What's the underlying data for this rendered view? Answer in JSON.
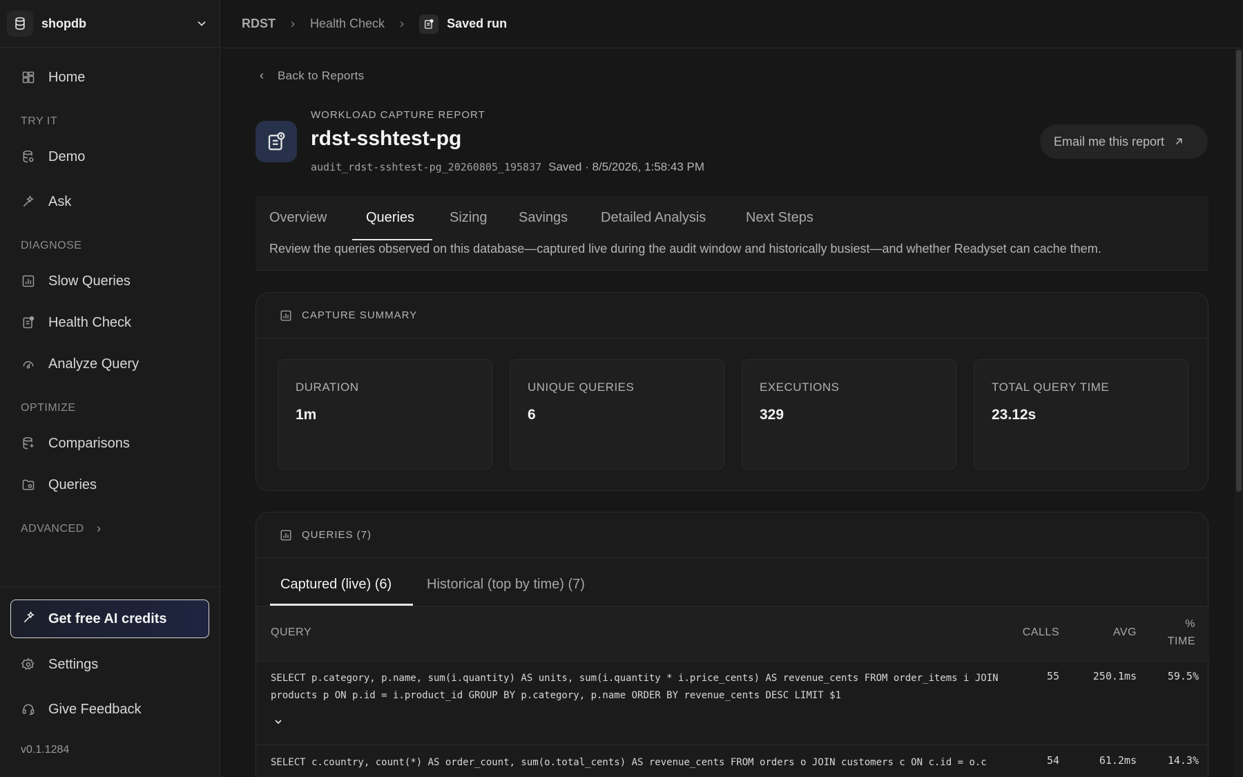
{
  "sidebar": {
    "db_name": "shopdb",
    "nav": {
      "home": "Home",
      "demo": "Demo",
      "ask": "Ask",
      "slow_queries": "Slow Queries",
      "health_check": "Health Check",
      "analyze_query": "Analyze Query",
      "comparisons": "Comparisons",
      "queries": "Queries"
    },
    "sections": {
      "try_it": "TRY IT",
      "diagnose": "DIAGNOSE",
      "optimize": "OPTIMIZE",
      "advanced": "ADVANCED"
    },
    "ai_credits": "Get free AI credits",
    "settings": "Settings",
    "feedback": "Give Feedback",
    "version": "v0.1.1284"
  },
  "breadcrumb": {
    "root": "RDST",
    "parent": "Health Check",
    "current": "Saved run"
  },
  "report": {
    "back_label": "Back to Reports",
    "kicker": "WORKLOAD CAPTURE REPORT",
    "title": "rdst-sshtest-pg",
    "audit_id": "audit_rdst-sshtest-pg_20260805_195837",
    "saved": "Saved · 8/5/2026, 1:58:43 PM",
    "email_button": "Email me this report"
  },
  "tabs": {
    "overview": "Overview",
    "queries": "Queries",
    "sizing": "Sizing",
    "savings": "Savings",
    "detailed": "Detailed Analysis",
    "next_steps": "Next Steps",
    "description": "Review the queries observed on this database—captured live during the audit window and historically busiest—and whether Readyset can cache them."
  },
  "capture_summary": {
    "title": "CAPTURE SUMMARY",
    "stats": [
      {
        "label": "DURATION",
        "value": "1m"
      },
      {
        "label": "UNIQUE QUERIES",
        "value": "6"
      },
      {
        "label": "EXECUTIONS",
        "value": "329"
      },
      {
        "label": "TOTAL QUERY TIME",
        "value": "23.12s"
      }
    ]
  },
  "queries_card": {
    "title": "QUERIES (7)",
    "subtabs": {
      "captured": "Captured (live) (6)",
      "historical": "Historical (top by time) (7)"
    },
    "columns": {
      "query": "QUERY",
      "calls": "CALLS",
      "avg": "AVG",
      "pct": "%",
      "time": "TIME"
    },
    "rows": [
      {
        "query": "SELECT p.category, p.name, sum(i.quantity) AS units, sum(i.quantity * i.price_cents) AS revenue_cents FROM order_items i JOIN products p ON p.id = i.product_id GROUP BY p.category, p.name ORDER BY revenue_cents DESC LIMIT $1",
        "calls": "55",
        "avg": "250.1ms",
        "pct_time": "59.5%"
      },
      {
        "query": "SELECT c.country, count(*) AS order_count, sum(o.total_cents) AS revenue_cents FROM orders o JOIN customers c ON c.id = o.c",
        "calls": "54",
        "avg": "61.2ms",
        "pct_time": "14.3%"
      }
    ]
  }
}
